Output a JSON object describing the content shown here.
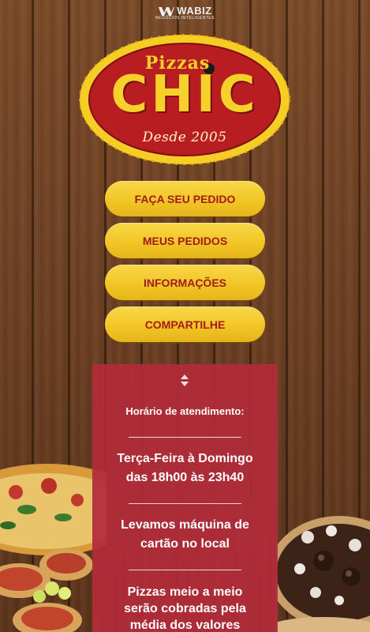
{
  "brand": {
    "name": "WABIZ",
    "tagline": "NEGÓCIOS INTELIGENTES"
  },
  "logo": {
    "top_word": "Pizzas",
    "main_word": "CHIC",
    "since": "Desde 2005",
    "colors": {
      "ring": "#f5cd24",
      "fill": "#b81d22",
      "text": "#f6d12a"
    }
  },
  "menu": {
    "items": [
      {
        "label": "FAÇA SEU PEDIDO"
      },
      {
        "label": "MEUS PEDIDOS"
      },
      {
        "label": "INFORMAÇÕES"
      },
      {
        "label": "COMPARTILHE"
      }
    ]
  },
  "info": {
    "hours_label": "Horário de atendimento:",
    "hours_days": "Terça-Feira à Domingo",
    "hours_time": "das 18h00 às 23h40",
    "card_line1": "Levamos máquina de",
    "card_line2": "cartão no local",
    "half_line1": "Pizzas meio a meio",
    "half_line2": "serão cobradas pela",
    "half_line3": "média dos valores"
  },
  "colors": {
    "button": "#f2c626",
    "button_text": "#a31a1f",
    "panel": "#b22c3a",
    "wood": "#6b4124"
  }
}
